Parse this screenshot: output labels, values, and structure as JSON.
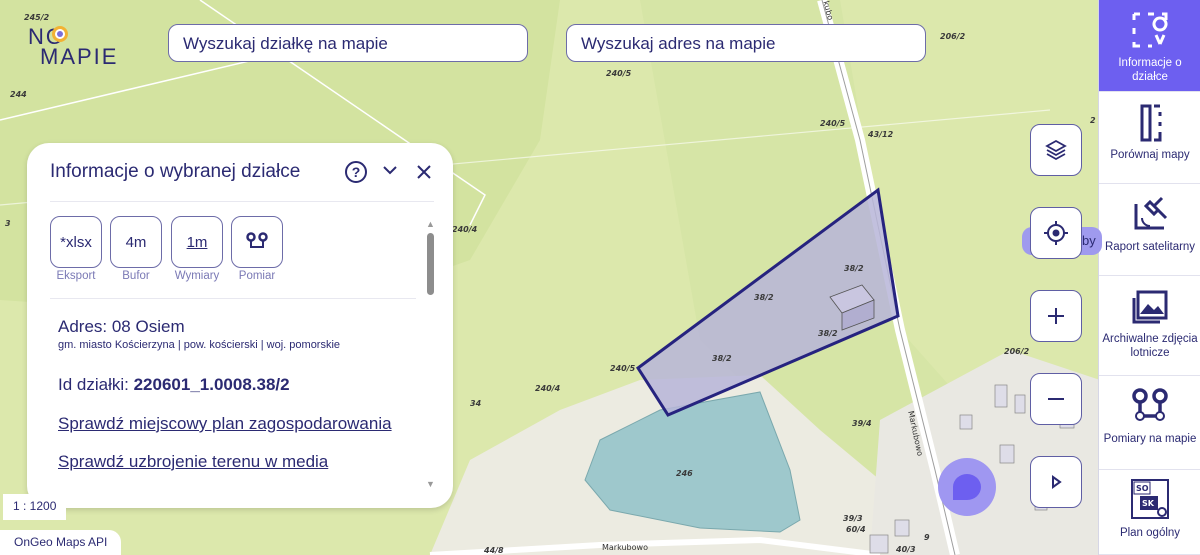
{
  "logo": {
    "line1": "NO",
    "line2": "MAPIE"
  },
  "search": {
    "plot_placeholder": "Wyszukaj działkę na mapie",
    "address_placeholder": "Wyszukaj adres na mapie"
  },
  "map": {
    "parcel_labels": [
      "245/2",
      "244",
      "240/5",
      "240/5",
      "43/12",
      "206/2",
      "2",
      "3",
      "240/4",
      "240/4",
      "38/2",
      "38/2",
      "38/2",
      "38/2",
      "240/5",
      "34",
      "206/2",
      "39/4",
      "246",
      "39/3",
      "60/4",
      "9",
      "40/3",
      "44/8"
    ],
    "streets": [
      "Markubowo",
      "Markubowo",
      "kubo"
    ],
    "parcel_fill": "#b7b5d8",
    "parcel_stroke": "#26237f",
    "water_color": "#9ec8cc"
  },
  "panel": {
    "title": "Informacje o wybranej działce",
    "help": "?",
    "chevron": "⌄",
    "close": "✕",
    "actions": [
      {
        "btn": "*xlsx",
        "label": "Eksport"
      },
      {
        "btn": "4m",
        "label": "Bufor"
      },
      {
        "btn": "1m",
        "label": "Wymiary"
      },
      {
        "btn": "",
        "label": "Pomiar"
      }
    ],
    "address": "Adres: 08 Osiem",
    "admin": "gm. miasto Kościerzyna | pow. kościerski | woj. pomorskie",
    "plot_id_label": "Id działki: ",
    "plot_id_value": "220601_1.0008.38/2",
    "link_mpzp": "Sprawdź miejscowy plan zagospodarowania",
    "link_media": "Sprawdź uzbrojenie terenu w media"
  },
  "geo_tooltip": "by",
  "scale": "1 : 1200",
  "attribution": "OnGeo Maps API",
  "toolbar": [
    {
      "label": "Informacje o działce",
      "icon": "plot-info-icon",
      "active": true
    },
    {
      "label": "Porównaj mapy",
      "icon": "compare-maps-icon",
      "active": false
    },
    {
      "label": "Raport satelitarny",
      "icon": "satellite-icon",
      "active": false
    },
    {
      "label": "Archiwalne zdjęcia lotnicze",
      "icon": "archive-photo-icon",
      "active": false
    },
    {
      "label": "Pomiary na mapie",
      "icon": "measure-icon",
      "active": false
    },
    {
      "label": "Plan ogólny",
      "icon": "general-plan-icon",
      "active": false
    }
  ],
  "colors": {
    "brand": "#2b2a72",
    "accent": "#6d5ff0"
  }
}
